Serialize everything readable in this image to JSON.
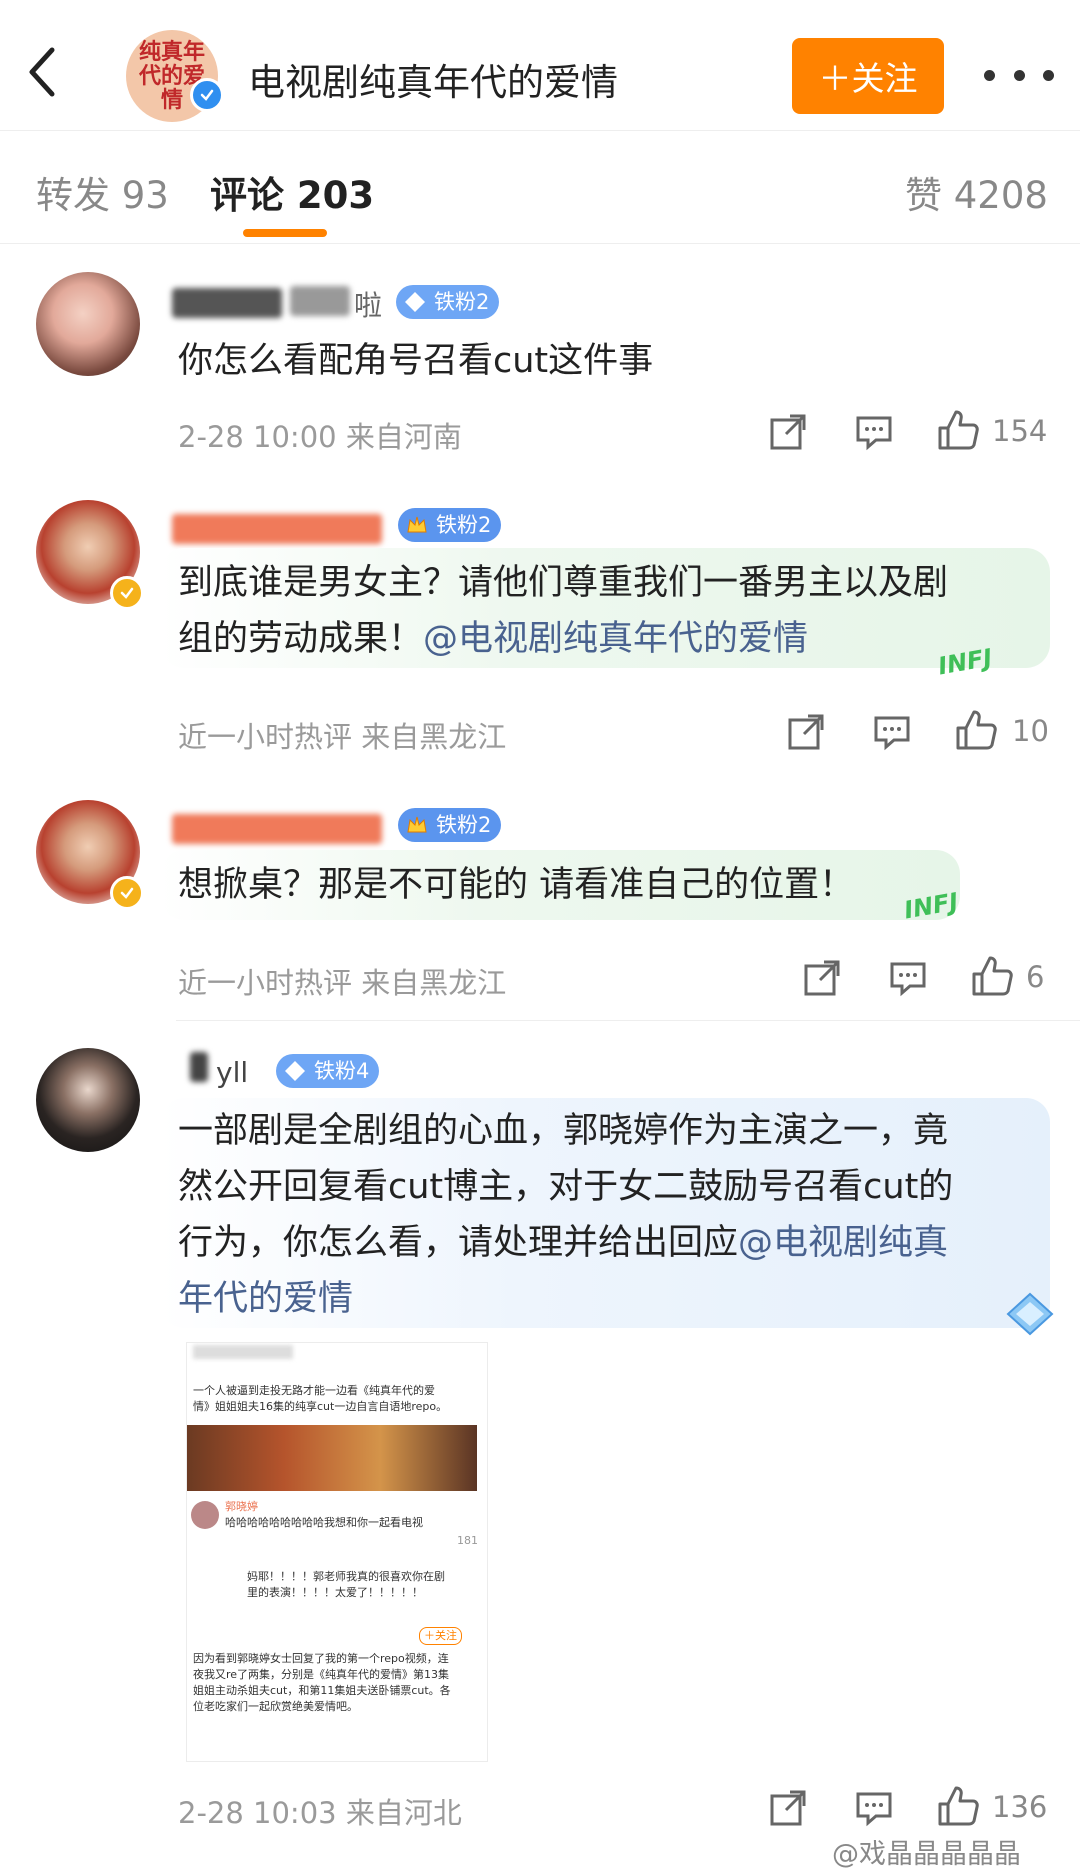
{
  "header": {
    "title": "电视剧纯真年代的爱情",
    "avatar_text": "纯真年代的爱情",
    "follow_label": "＋关注"
  },
  "tabs": [
    {
      "label": "转发 93"
    },
    {
      "label": "评论 203"
    },
    {
      "label": "赞 4208"
    }
  ],
  "comments": [
    {
      "username_visible": "啦",
      "badge": "铁粉2",
      "text": "你怎么看配角号召看cut这件事",
      "time": "2-28 10:00 来自河南",
      "likes": "154"
    },
    {
      "badge": "铁粉2",
      "text_a": "到底谁是男女主？请他们尊重我们一番男主以及剧",
      "text_b": "组的劳动成果！",
      "mention": "@电视剧纯真年代的爱情",
      "time": "近一小时热评 来自黑龙江",
      "likes": "10",
      "sticker": "INFJ"
    },
    {
      "badge": "铁粉2",
      "text": "想掀桌？那是不可能的 请看准自己的位置！",
      "time": "近一小时热评 来自黑龙江",
      "likes": "6",
      "sticker": "INFJ"
    },
    {
      "username_visible": "yll",
      "badge": "铁粉4",
      "line1": "一部剧是全剧组的心血，郭晓婷作为主演之一，竟",
      "line2": "然公开回复看cut博主，对于女二鼓励号召看cut的",
      "line3a": "行为，你怎么看，请处理并给出回应",
      "mention_a": "@电视剧纯真",
      "mention_b": "年代的爱情",
      "time": "2-28 10:03 来自河北",
      "likes": "136",
      "embedded": {
        "top_line1": "一个人被逼到走投无路才能一边看《纯真年代的爱",
        "top_line2": "情》姐姐姐夫16集的纯享cut一边自言自语地repo。",
        "reply_name": "郭晓婷",
        "reply_text": "哈哈哈哈哈哈哈哈哈我想和你一起看电视",
        "reply_likes": "181",
        "sub_text1": "妈耶！！！！郭老师我真的很喜欢你在剧",
        "sub_text2": "里的表演！！！！太爱了！！！！！",
        "follow": "＋关注",
        "body1": "因为看到郭晓婷女士回复了我的第一个repo视频，连",
        "body2": "夜我又re了两集，分别是《纯真年代的爱情》第13集",
        "body3": "姐姐主动杀姐夫cut，和第11集姐夫送卧铺票cut。各",
        "body4": "位老吃家们一起欣赏绝美爱情吧。"
      }
    }
  ],
  "watermark": "@戏晶晶晶晶晶",
  "colors": {
    "accent": "#ff8200",
    "username": "#eb7350",
    "mention": "#49628f",
    "badge": "#6ea6f5",
    "meta": "#9a9a9a"
  }
}
